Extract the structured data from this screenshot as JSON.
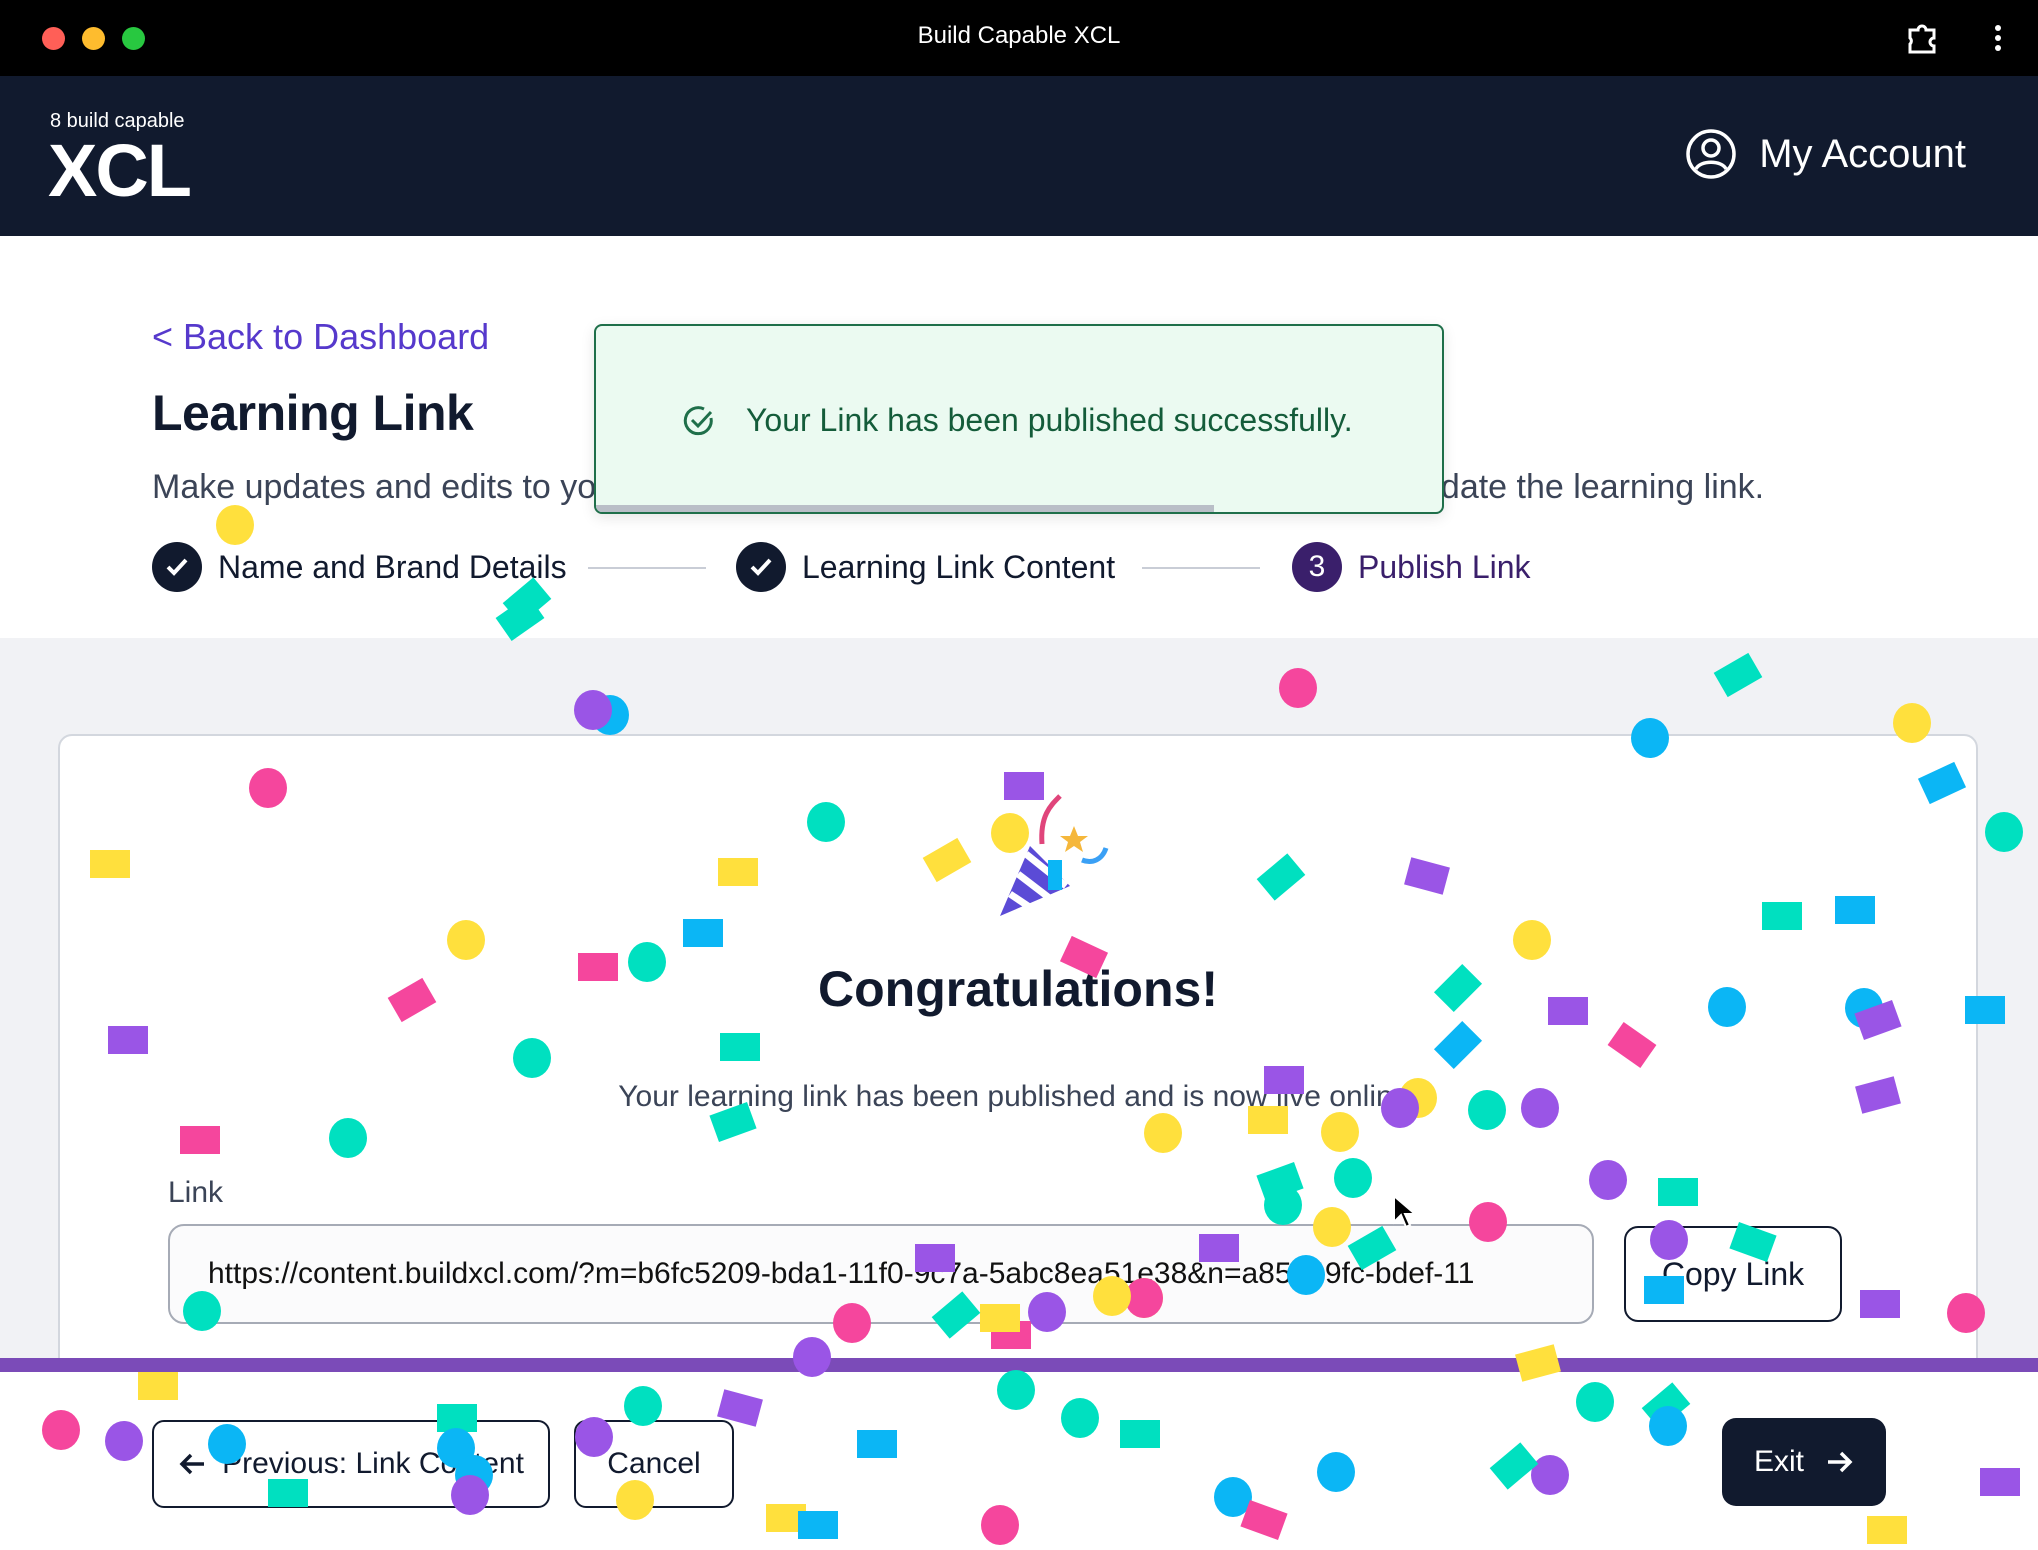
{
  "window": {
    "title": "Build Capable XCL"
  },
  "header": {
    "brand_small": "8 build capable",
    "brand_big": "XCL",
    "account_label": "My Account"
  },
  "page": {
    "back_link": "< Back to Dashboard",
    "title": "Learning Link",
    "description_start": "Make updates and edits to yo",
    "description_end": "pdate the learning link."
  },
  "stepper": {
    "steps": [
      {
        "label": "Name and Brand Details",
        "state": "complete"
      },
      {
        "label": "Learning Link Content",
        "state": "complete"
      },
      {
        "label": "Publish Link",
        "state": "current",
        "number": "3"
      }
    ]
  },
  "toast": {
    "message": "Your Link has been published successfully.",
    "progress": 0.73
  },
  "card": {
    "heading": "Congratulations!",
    "subtext": "Your learning link has been published and is now live online.",
    "link_label": "Link",
    "link_value": "https://content.buildxcl.com/?m=b6fc5209-bda1-11f0-9c7a-5abc8ea51e38&n=a85549fc-bdef-11",
    "copy_label": "Copy Link"
  },
  "footer": {
    "prev_label": "Previous: Link Content",
    "cancel_label": "Cancel",
    "exit_label": "Exit"
  },
  "colors": {
    "confetti": [
      "#ffe03d",
      "#00e0c0",
      "#0bb6f5",
      "#9a55e6",
      "#f5469d"
    ],
    "accent": "#5639cc",
    "nav": "#111a2e"
  }
}
